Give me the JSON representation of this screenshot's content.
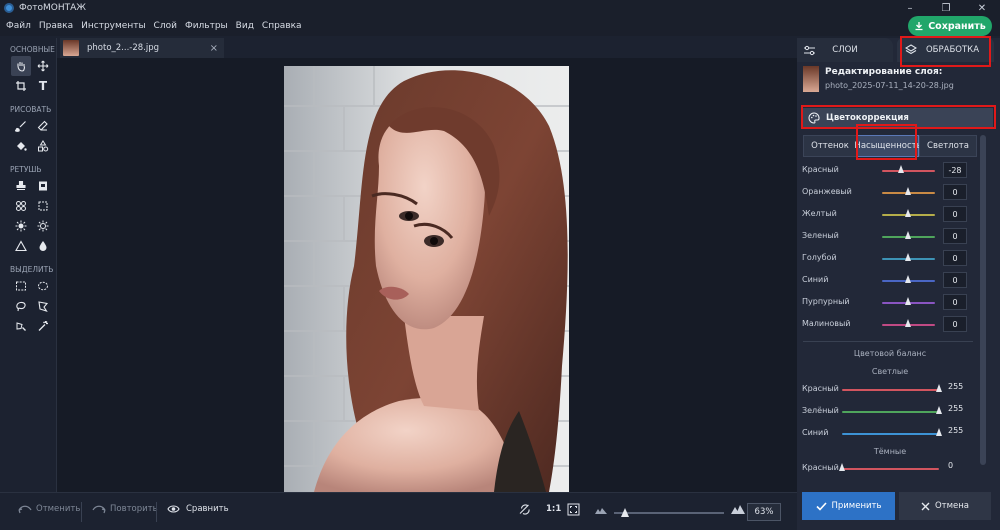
{
  "app": {
    "title": "ФотоМОНТАЖ"
  },
  "menu": [
    "Файл",
    "Правка",
    "Инструменты",
    "Слой",
    "Фильтры",
    "Вид",
    "Справка"
  ],
  "save_label": "Сохранить",
  "toolbar": {
    "sections": [
      "ОСНОВНЫЕ",
      "РИСОВАТЬ",
      "РЕТУШЬ",
      "ВЫДЕЛИТЬ"
    ]
  },
  "document_tab": {
    "label": "photo_2...-28.jpg",
    "close": "×"
  },
  "bottom": {
    "undo": "Отменить",
    "redo": "Повторить",
    "compare": "Сравнить",
    "ratio": "1:1",
    "zoom": "63%",
    "zoom_fraction": 0.05
  },
  "panel": {
    "tab_layers": "СЛОИ",
    "tab_processing": "ОБРАБОТКА",
    "layer_title": "Редактирование слоя:",
    "layer_file": "photo_2025-07-11_14-20-28.jpg",
    "section": "Цветокоррекция",
    "subtabs": [
      "Оттенок",
      "Насыщенность",
      "Светлота"
    ],
    "saturation": [
      {
        "label": "Красный",
        "value": "-28",
        "norm": 0.36,
        "color": "#d2555f"
      },
      {
        "label": "Оранжевый",
        "value": "0",
        "norm": 0.5,
        "color": "#c98a45"
      },
      {
        "label": "Желтый",
        "value": "0",
        "norm": 0.5,
        "color": "#b5ad4a"
      },
      {
        "label": "Зеленый",
        "value": "0",
        "norm": 0.5,
        "color": "#4fa55c"
      },
      {
        "label": "Голубой",
        "value": "0",
        "norm": 0.5,
        "color": "#3d93b5"
      },
      {
        "label": "Синий",
        "value": "0",
        "norm": 0.5,
        "color": "#4a66c4"
      },
      {
        "label": "Пурпурный",
        "value": "0",
        "norm": 0.5,
        "color": "#8a55c2"
      },
      {
        "label": "Малиновый",
        "value": "0",
        "norm": 0.5,
        "color": "#c04a84"
      }
    ],
    "balance_title": "Цветовой баланс",
    "lights_title": "Светлые",
    "lights": [
      {
        "label": "Красный",
        "value": "255",
        "norm": 1.0,
        "color": "#d2555f"
      },
      {
        "label": "Зелёный",
        "value": "255",
        "norm": 1.0,
        "color": "#4fa55c"
      },
      {
        "label": "Синий",
        "value": "255",
        "norm": 1.0,
        "color": "#3d93d5"
      }
    ],
    "darks_title": "Тёмные",
    "darks": [
      {
        "label": "Красный",
        "value": "0",
        "norm": 0.0,
        "color": "#d2555f"
      }
    ],
    "apply": "Применить",
    "cancel": "Отмена"
  }
}
